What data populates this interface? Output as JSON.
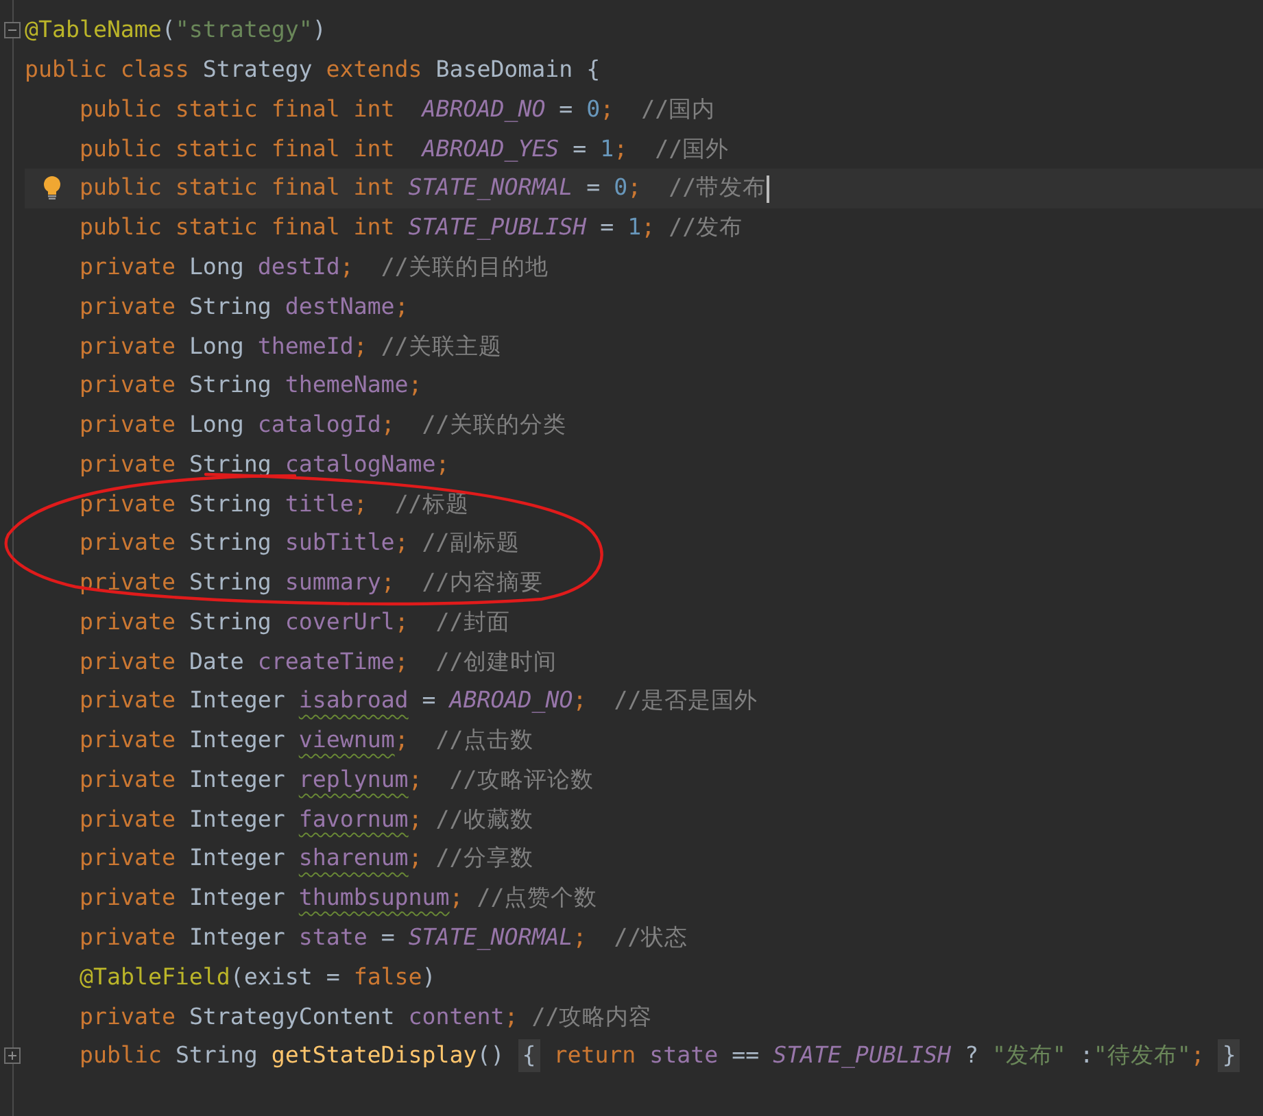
{
  "editor": {
    "lines": [
      {
        "kind": "fold_open",
        "current": false,
        "tokens": [
          {
            "kind": "annot",
            "t": "@TableName"
          },
          {
            "kind": "plain",
            "t": "("
          },
          {
            "kind": "str",
            "t": "\"strategy\""
          },
          {
            "kind": "plain",
            "t": ")"
          }
        ]
      },
      {
        "kind": "code",
        "current": false,
        "tokens": [
          {
            "kind": "kw",
            "t": "public class "
          },
          {
            "kind": "plain",
            "t": "Strategy "
          },
          {
            "kind": "kw",
            "t": "extends "
          },
          {
            "kind": "plain",
            "t": "BaseDomain {"
          }
        ],
        "children": [
          {
            "kind": "code",
            "current": false,
            "tokens": [
              {
                "kind": "kw",
                "t": "public static final int  "
              },
              {
                "kind": "const",
                "t": "ABROAD_NO"
              },
              {
                "kind": "plain",
                "t": " = "
              },
              {
                "kind": "num",
                "t": "0"
              },
              {
                "kind": "kw",
                "t": ";  "
              },
              {
                "kind": "comment",
                "t": "//国内"
              }
            ]
          },
          {
            "kind": "code",
            "current": false,
            "tokens": [
              {
                "kind": "kw",
                "t": "public static final int  "
              },
              {
                "kind": "const",
                "t": "ABROAD_YES"
              },
              {
                "kind": "plain",
                "t": " = "
              },
              {
                "kind": "num",
                "t": "1"
              },
              {
                "kind": "kw",
                "t": ";  "
              },
              {
                "kind": "comment",
                "t": "//国外"
              }
            ]
          },
          {
            "kind": "bulb",
            "current": true,
            "tokens": [
              {
                "kind": "kw",
                "t": "public static final int "
              },
              {
                "kind": "const",
                "t": "STATE_NORMAL"
              },
              {
                "kind": "plain",
                "t": " = "
              },
              {
                "kind": "num",
                "t": "0"
              },
              {
                "kind": "kw",
                "t": ";  "
              },
              {
                "kind": "comment",
                "t": "//带发布"
              }
            ]
          },
          {
            "kind": "code",
            "current": false,
            "tokens": [
              {
                "kind": "kw",
                "t": "public static final int "
              },
              {
                "kind": "const",
                "t": "STATE_PUBLISH"
              },
              {
                "kind": "plain",
                "t": " = "
              },
              {
                "kind": "num",
                "t": "1"
              },
              {
                "kind": "kw",
                "t": "; "
              },
              {
                "kind": "comment",
                "t": "//发布"
              }
            ]
          },
          {
            "kind": "code",
            "current": false,
            "tokens": [
              {
                "kind": "kw",
                "t": "private "
              },
              {
                "kind": "plain",
                "t": "Long "
              },
              {
                "kind": "field",
                "t": "destId"
              },
              {
                "kind": "kw",
                "t": ";  "
              },
              {
                "kind": "comment",
                "t": "//关联的目的地"
              }
            ]
          },
          {
            "kind": "code",
            "current": false,
            "tokens": [
              {
                "kind": "kw",
                "t": "private "
              },
              {
                "kind": "plain",
                "t": "String "
              },
              {
                "kind": "field",
                "t": "destName"
              },
              {
                "kind": "kw",
                "t": ";"
              }
            ]
          },
          {
            "kind": "code",
            "current": false,
            "tokens": [
              {
                "kind": "kw",
                "t": "private "
              },
              {
                "kind": "plain",
                "t": "Long "
              },
              {
                "kind": "field",
                "t": "themeId"
              },
              {
                "kind": "kw",
                "t": "; "
              },
              {
                "kind": "comment",
                "t": "//关联主题"
              }
            ]
          },
          {
            "kind": "code",
            "current": false,
            "tokens": [
              {
                "kind": "kw",
                "t": "private "
              },
              {
                "kind": "plain",
                "t": "String "
              },
              {
                "kind": "field",
                "t": "themeName"
              },
              {
                "kind": "kw",
                "t": ";"
              }
            ]
          },
          {
            "kind": "code",
            "current": false,
            "tokens": [
              {
                "kind": "kw",
                "t": "private "
              },
              {
                "kind": "plain",
                "t": "Long "
              },
              {
                "kind": "field",
                "t": "catalogId"
              },
              {
                "kind": "kw",
                "t": ";  "
              },
              {
                "kind": "comment",
                "t": "//关联的分类"
              }
            ]
          },
          {
            "kind": "code",
            "current": false,
            "tokens": [
              {
                "kind": "kw",
                "t": "private "
              },
              {
                "kind": "plain",
                "t": "String "
              },
              {
                "kind": "field",
                "t": "catalogName"
              },
              {
                "kind": "kw",
                "t": ";"
              }
            ]
          },
          {
            "kind": "code",
            "current": false,
            "tokens": [
              {
                "kind": "kw",
                "t": "private "
              },
              {
                "kind": "plain",
                "t": "String "
              },
              {
                "kind": "field",
                "t": "title"
              },
              {
                "kind": "kw",
                "t": ";  "
              },
              {
                "kind": "comment",
                "t": "//标题"
              }
            ]
          },
          {
            "kind": "code",
            "current": false,
            "tokens": [
              {
                "kind": "kw",
                "t": "private "
              },
              {
                "kind": "plain",
                "t": "String "
              },
              {
                "kind": "field",
                "t": "subTitle"
              },
              {
                "kind": "kw",
                "t": "; "
              },
              {
                "kind": "comment",
                "t": "//副标题"
              }
            ]
          },
          {
            "kind": "code",
            "current": false,
            "tokens": [
              {
                "kind": "kw",
                "t": "private "
              },
              {
                "kind": "plain",
                "t": "String "
              },
              {
                "kind": "field",
                "t": "summary"
              },
              {
                "kind": "kw",
                "t": ";  "
              },
              {
                "kind": "comment",
                "t": "//内容摘要"
              }
            ]
          },
          {
            "kind": "code",
            "current": false,
            "tokens": [
              {
                "kind": "kw",
                "t": "private "
              },
              {
                "kind": "plain",
                "t": "String "
              },
              {
                "kind": "field",
                "t": "coverUrl"
              },
              {
                "kind": "kw",
                "t": ";  "
              },
              {
                "kind": "comment",
                "t": "//封面"
              }
            ]
          },
          {
            "kind": "code",
            "current": false,
            "tokens": [
              {
                "kind": "kw",
                "t": "private "
              },
              {
                "kind": "plain",
                "t": "Date "
              },
              {
                "kind": "field",
                "t": "createTime"
              },
              {
                "kind": "kw",
                "t": ";  "
              },
              {
                "kind": "comment",
                "t": "//创建时间"
              }
            ]
          },
          {
            "kind": "code",
            "current": false,
            "tokens": [
              {
                "kind": "kw",
                "t": "private "
              },
              {
                "kind": "plain",
                "t": "Integer "
              },
              {
                "kind": "field",
                "t": "isabroad",
                "warn": true
              },
              {
                "kind": "plain",
                "t": " = "
              },
              {
                "kind": "const",
                "t": "ABROAD_NO"
              },
              {
                "kind": "kw",
                "t": ";  "
              },
              {
                "kind": "comment",
                "t": "//是否是国外"
              }
            ]
          },
          {
            "kind": "code",
            "current": false,
            "tokens": [
              {
                "kind": "kw",
                "t": "private "
              },
              {
                "kind": "plain",
                "t": "Integer "
              },
              {
                "kind": "field",
                "t": "viewnum",
                "warn": true
              },
              {
                "kind": "kw",
                "t": ";  "
              },
              {
                "kind": "comment",
                "t": "//点击数"
              }
            ]
          },
          {
            "kind": "code",
            "current": false,
            "tokens": [
              {
                "kind": "kw",
                "t": "private "
              },
              {
                "kind": "plain",
                "t": "Integer "
              },
              {
                "kind": "field",
                "t": "replynum",
                "warn": true
              },
              {
                "kind": "kw",
                "t": ";  "
              },
              {
                "kind": "comment",
                "t": "//攻略评论数"
              }
            ]
          },
          {
            "kind": "code",
            "current": false,
            "tokens": [
              {
                "kind": "kw",
                "t": "private "
              },
              {
                "kind": "plain",
                "t": "Integer "
              },
              {
                "kind": "field",
                "t": "favornum",
                "warn": true
              },
              {
                "kind": "kw",
                "t": "; "
              },
              {
                "kind": "comment",
                "t": "//收藏数"
              }
            ]
          },
          {
            "kind": "code",
            "current": false,
            "tokens": [
              {
                "kind": "kw",
                "t": "private "
              },
              {
                "kind": "plain",
                "t": "Integer "
              },
              {
                "kind": "field",
                "t": "sharenum",
                "warn": true
              },
              {
                "kind": "kw",
                "t": "; "
              },
              {
                "kind": "comment",
                "t": "//分享数"
              }
            ]
          },
          {
            "kind": "code",
            "current": false,
            "tokens": [
              {
                "kind": "kw",
                "t": "private "
              },
              {
                "kind": "plain",
                "t": "Integer "
              },
              {
                "kind": "field",
                "t": "thumbsupnum",
                "warn": true
              },
              {
                "kind": "kw",
                "t": "; "
              },
              {
                "kind": "comment",
                "t": "//点赞个数"
              }
            ]
          },
          {
            "kind": "code",
            "current": false,
            "tokens": [
              {
                "kind": "kw",
                "t": "private "
              },
              {
                "kind": "plain",
                "t": "Integer "
              },
              {
                "kind": "field",
                "t": "state"
              },
              {
                "kind": "plain",
                "t": " = "
              },
              {
                "kind": "const",
                "t": "STATE_NORMAL"
              },
              {
                "kind": "kw",
                "t": ";  "
              },
              {
                "kind": "comment",
                "t": "//状态"
              }
            ]
          },
          {
            "kind": "code",
            "current": false,
            "tokens": [
              {
                "kind": "annot",
                "t": "@TableField"
              },
              {
                "kind": "plain",
                "t": "(exist = "
              },
              {
                "kind": "kw",
                "t": "false"
              },
              {
                "kind": "plain",
                "t": ")"
              }
            ]
          },
          {
            "kind": "code",
            "current": false,
            "tokens": [
              {
                "kind": "kw",
                "t": "private "
              },
              {
                "kind": "plain",
                "t": "StrategyContent "
              },
              {
                "kind": "field",
                "t": "content"
              },
              {
                "kind": "kw",
                "t": "; "
              },
              {
                "kind": "comment",
                "t": "//攻略内容"
              }
            ]
          },
          {
            "kind": "fold_closed",
            "current": false,
            "tokens": [
              {
                "kind": "kw",
                "t": "public "
              },
              {
                "kind": "plain",
                "t": "String "
              },
              {
                "kind": "method",
                "t": "getStateDisplay"
              },
              {
                "kind": "plain",
                "t": "() "
              },
              {
                "kind": "fold",
                "t": "{"
              },
              {
                "kind": "kw",
                "t": "return "
              },
              {
                "kind": "field",
                "t": "state"
              },
              {
                "kind": "plain",
                "t": " == "
              },
              {
                "kind": "const",
                "t": "STATE_PUBLISH"
              },
              {
                "kind": "plain",
                "t": " ? "
              },
              {
                "kind": "str",
                "t": "\"发布\""
              },
              {
                "kind": "plain",
                "t": " :"
              },
              {
                "kind": "str",
                "t": "\"待发布\""
              },
              {
                "kind": "kw",
                "t": "; "
              },
              {
                "kind": "fold",
                "t": "}"
              }
            ]
          }
        ]
      }
    ]
  },
  "markup": {
    "kind": "ellipse"
  }
}
